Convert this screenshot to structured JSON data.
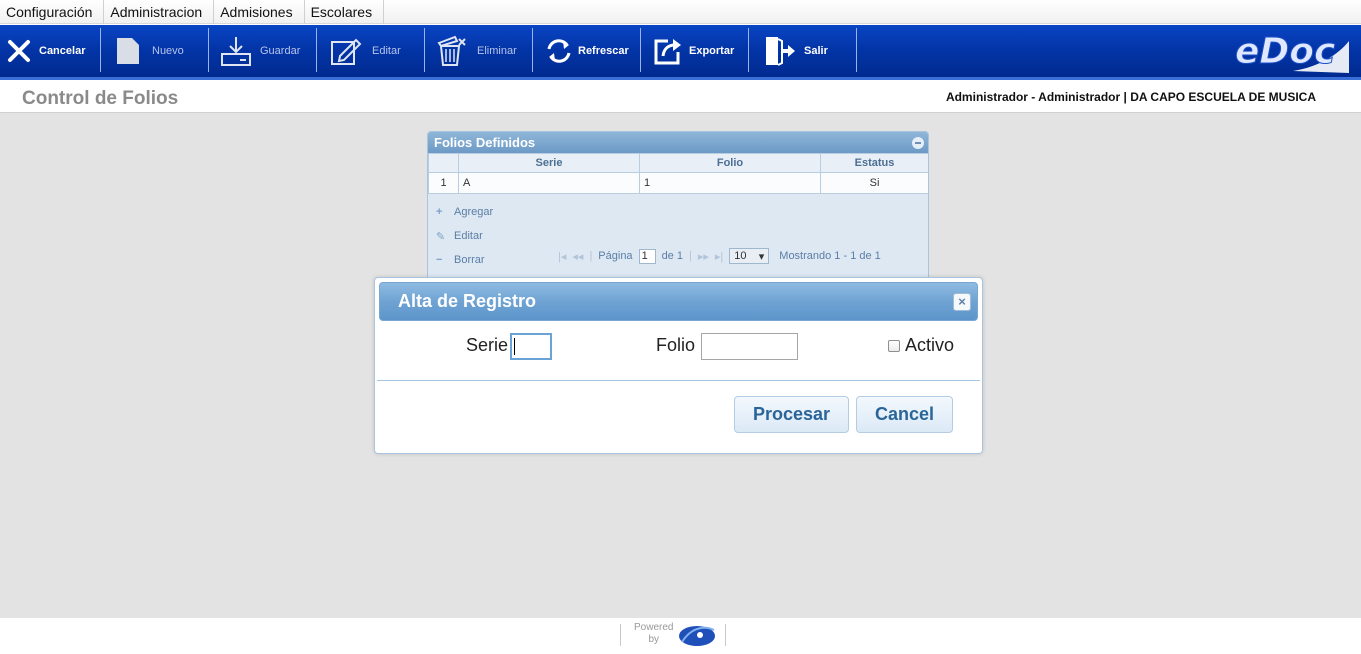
{
  "menu": {
    "items": [
      {
        "label": "Configuración"
      },
      {
        "label": "Administracion"
      },
      {
        "label": "Admisiones"
      },
      {
        "label": "Escolares"
      }
    ]
  },
  "toolbar": {
    "cancel_label": "Cancelar",
    "new_label": "Nuevo",
    "save_label": "Guardar",
    "edit_label": "Editar",
    "delete_label": "Eliminar",
    "refresh_label": "Refrescar",
    "export_label": "Exportar",
    "exit_label": "Salir",
    "logo": "eDoc"
  },
  "page": {
    "title": "Control de Folios",
    "user_info": "Administrador - Administrador | DA CAPO ESCUELA DE MUSICA"
  },
  "grid": {
    "caption": "Folios Definidos",
    "columns": [
      "Serie",
      "Folio",
      "Estatus"
    ],
    "rows": [
      {
        "num": "1",
        "serie": "A",
        "folio": "1",
        "estatus": "Si"
      }
    ],
    "actions": {
      "add": "Agregar",
      "edit": "Editar",
      "delete": "Borrar"
    },
    "pager": {
      "page_label": "Página",
      "page_value": "1",
      "of_label": "de 1",
      "rows_per_page": "10",
      "showing": "Mostrando 1 - 1 de 1"
    }
  },
  "dialog": {
    "title": "Alta de Registro",
    "serie_label": "Serie",
    "serie_value": "",
    "folio_label": "Folio",
    "folio_value": "",
    "activo_label": "Activo",
    "activo_checked": false,
    "process_button": "Procesar",
    "cancel_button": "Cancel"
  },
  "footer": {
    "powered_line1": "Powered",
    "powered_line2": "by"
  },
  "colors": {
    "toolbar_bg": "#0335a8",
    "dialog_header": "#6fa3d3",
    "content_bg": "#e3e3e3",
    "button_text": "#2a6599"
  }
}
